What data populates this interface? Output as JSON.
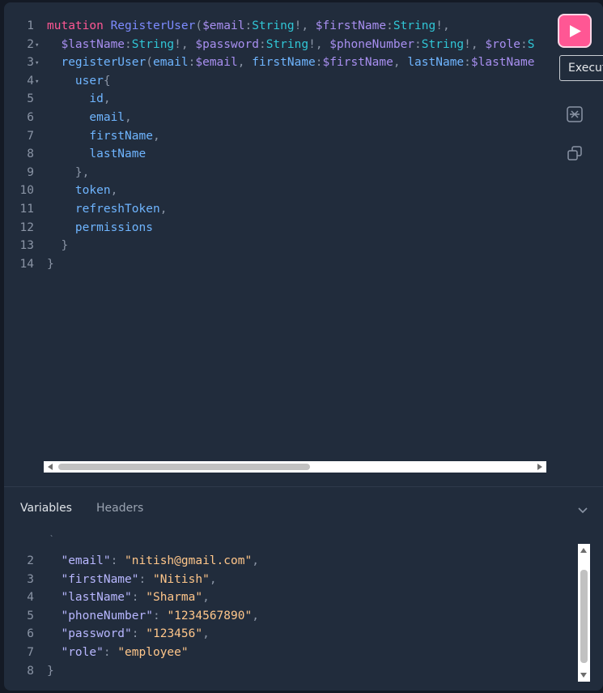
{
  "query": {
    "lines": [
      {
        "n": "1",
        "fold": "",
        "tokens": [
          {
            "t": "mutation",
            "c": "kw"
          },
          {
            "t": " ",
            "c": ""
          },
          {
            "t": "RegisterUser",
            "c": "def"
          },
          {
            "t": "(",
            "c": "punc"
          },
          {
            "t": "$email",
            "c": "var"
          },
          {
            "t": ":",
            "c": "punc"
          },
          {
            "t": "String",
            "c": "type"
          },
          {
            "t": "!",
            "c": "punc"
          },
          {
            "t": ", ",
            "c": "punc"
          },
          {
            "t": "$firstName",
            "c": "var"
          },
          {
            "t": ":",
            "c": "punc"
          },
          {
            "t": "String",
            "c": "type"
          },
          {
            "t": "!",
            "c": "punc"
          },
          {
            "t": ",",
            "c": "punc"
          }
        ]
      },
      {
        "n": "2",
        "fold": "▾",
        "tokens": [
          {
            "t": "  ",
            "c": ""
          },
          {
            "t": "$lastName",
            "c": "var"
          },
          {
            "t": ":",
            "c": "punc"
          },
          {
            "t": "String",
            "c": "type"
          },
          {
            "t": "!",
            "c": "punc"
          },
          {
            "t": ", ",
            "c": "punc"
          },
          {
            "t": "$password",
            "c": "var"
          },
          {
            "t": ":",
            "c": "punc"
          },
          {
            "t": "String",
            "c": "type"
          },
          {
            "t": "!",
            "c": "punc"
          },
          {
            "t": ", ",
            "c": "punc"
          },
          {
            "t": "$phoneNumber",
            "c": "var"
          },
          {
            "t": ":",
            "c": "punc"
          },
          {
            "t": "String",
            "c": "type"
          },
          {
            "t": "!",
            "c": "punc"
          },
          {
            "t": ", ",
            "c": "punc"
          },
          {
            "t": "$role",
            "c": "var"
          },
          {
            "t": ":",
            "c": "punc"
          },
          {
            "t": "S",
            "c": "type"
          }
        ]
      },
      {
        "n": "3",
        "fold": "▾",
        "tokens": [
          {
            "t": "  ",
            "c": ""
          },
          {
            "t": "registerUser",
            "c": "field"
          },
          {
            "t": "(",
            "c": "punc"
          },
          {
            "t": "email",
            "c": "field"
          },
          {
            "t": ":",
            "c": "punc"
          },
          {
            "t": "$email",
            "c": "var"
          },
          {
            "t": ", ",
            "c": "punc"
          },
          {
            "t": "firstName",
            "c": "field"
          },
          {
            "t": ":",
            "c": "punc"
          },
          {
            "t": "$firstName",
            "c": "var"
          },
          {
            "t": ", ",
            "c": "punc"
          },
          {
            "t": "lastName",
            "c": "field"
          },
          {
            "t": ":",
            "c": "punc"
          },
          {
            "t": "$lastName",
            "c": "var"
          }
        ]
      },
      {
        "n": "4",
        "fold": "▾",
        "tokens": [
          {
            "t": "    ",
            "c": ""
          },
          {
            "t": "user",
            "c": "field"
          },
          {
            "t": "{",
            "c": "punc"
          }
        ]
      },
      {
        "n": "5",
        "fold": "",
        "tokens": [
          {
            "t": "      ",
            "c": ""
          },
          {
            "t": "id",
            "c": "field"
          },
          {
            "t": ",",
            "c": "punc"
          }
        ]
      },
      {
        "n": "6",
        "fold": "",
        "tokens": [
          {
            "t": "      ",
            "c": ""
          },
          {
            "t": "email",
            "c": "field"
          },
          {
            "t": ",",
            "c": "punc"
          }
        ]
      },
      {
        "n": "7",
        "fold": "",
        "tokens": [
          {
            "t": "      ",
            "c": ""
          },
          {
            "t": "firstName",
            "c": "field"
          },
          {
            "t": ",",
            "c": "punc"
          }
        ]
      },
      {
        "n": "8",
        "fold": "",
        "tokens": [
          {
            "t": "      ",
            "c": ""
          },
          {
            "t": "lastName",
            "c": "field"
          }
        ]
      },
      {
        "n": "9",
        "fold": "",
        "tokens": [
          {
            "t": "    ",
            "c": ""
          },
          {
            "t": "},",
            "c": "punc"
          }
        ]
      },
      {
        "n": "10",
        "fold": "",
        "tokens": [
          {
            "t": "    ",
            "c": ""
          },
          {
            "t": "token",
            "c": "field"
          },
          {
            "t": ",",
            "c": "punc"
          }
        ]
      },
      {
        "n": "11",
        "fold": "",
        "tokens": [
          {
            "t": "    ",
            "c": ""
          },
          {
            "t": "refreshToken",
            "c": "field"
          },
          {
            "t": ",",
            "c": "punc"
          }
        ]
      },
      {
        "n": "12",
        "fold": "",
        "tokens": [
          {
            "t": "    ",
            "c": ""
          },
          {
            "t": "permissions",
            "c": "field"
          }
        ]
      },
      {
        "n": "13",
        "fold": "",
        "tokens": [
          {
            "t": "  ",
            "c": ""
          },
          {
            "t": "}",
            "c": "punc"
          }
        ]
      },
      {
        "n": "14",
        "fold": "",
        "tokens": [
          {
            "t": "}",
            "c": "punc"
          }
        ]
      }
    ]
  },
  "toolbar": {
    "execute_tooltip": "Execute"
  },
  "tabs": {
    "variables": "Variables",
    "headers": "Headers"
  },
  "variables": {
    "lines": [
      {
        "n": "2",
        "tokens": [
          {
            "t": "  ",
            "c": ""
          },
          {
            "t": "\"email\"",
            "c": "key"
          },
          {
            "t": ": ",
            "c": "punc"
          },
          {
            "t": "\"nitish@gmail.com\"",
            "c": "str"
          },
          {
            "t": ",",
            "c": "punc"
          }
        ]
      },
      {
        "n": "3",
        "tokens": [
          {
            "t": "  ",
            "c": ""
          },
          {
            "t": "\"firstName\"",
            "c": "key"
          },
          {
            "t": ": ",
            "c": "punc"
          },
          {
            "t": "\"Nitish\"",
            "c": "str"
          },
          {
            "t": ",",
            "c": "punc"
          }
        ]
      },
      {
        "n": "4",
        "tokens": [
          {
            "t": "  ",
            "c": ""
          },
          {
            "t": "\"lastName\"",
            "c": "key"
          },
          {
            "t": ": ",
            "c": "punc"
          },
          {
            "t": "\"Sharma\"",
            "c": "str"
          },
          {
            "t": ",",
            "c": "punc"
          }
        ]
      },
      {
        "n": "5",
        "tokens": [
          {
            "t": "  ",
            "c": ""
          },
          {
            "t": "\"phoneNumber\"",
            "c": "key"
          },
          {
            "t": ": ",
            "c": "punc"
          },
          {
            "t": "\"1234567890\"",
            "c": "str"
          },
          {
            "t": ",",
            "c": "punc"
          }
        ]
      },
      {
        "n": "6",
        "tokens": [
          {
            "t": "  ",
            "c": ""
          },
          {
            "t": "\"password\"",
            "c": "key"
          },
          {
            "t": ": ",
            "c": "punc"
          },
          {
            "t": "\"123456\"",
            "c": "str"
          },
          {
            "t": ",",
            "c": "punc"
          }
        ]
      },
      {
        "n": "7",
        "tokens": [
          {
            "t": "  ",
            "c": ""
          },
          {
            "t": "\"role\"",
            "c": "key"
          },
          {
            "t": ": ",
            "c": "punc"
          },
          {
            "t": "\"employee\"",
            "c": "str"
          }
        ]
      },
      {
        "n": "8",
        "tokens": [
          {
            "t": "}",
            "c": "punc"
          }
        ]
      }
    ]
  },
  "colors": {
    "accent": "#ff5794",
    "panel": "#212c3c",
    "background": "#141a25"
  }
}
